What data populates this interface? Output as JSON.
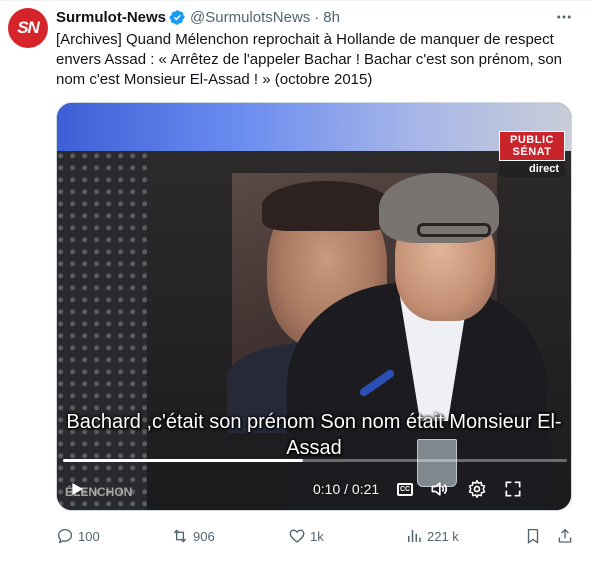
{
  "tweet": {
    "author_name": "Surmulot-News",
    "avatar_text": "SN",
    "handle": "@SurmulotsNews",
    "separator": "·",
    "time": "8h",
    "text": "[Archives] Quand Mélenchon reprochait à Hollande de manquer de respect envers Assad : « Arrêtez de l'appeler Bachar ! Bachar c'est son prénom, son nom c'est Monsieur El-Assad ! » (octobre 2015)"
  },
  "video": {
    "channel_line1": "PUBLIC",
    "channel_line2": "SÉNAT",
    "live_tag": "direct",
    "subtitle": "Bachard ,c'était son prénom Son nom était Monsieur El-Assad",
    "lower_third": "ÉLENCHON",
    "elapsed": "0:10",
    "duration": "0:21",
    "time_separator": " / ",
    "progress_fraction": 0.476,
    "cc_label": "CC"
  },
  "actions": {
    "replies": "100",
    "reposts": "906",
    "likes": "1k",
    "views": "221 k"
  },
  "colors": {
    "verified": "#1d9bf0",
    "muted_text": "#536471",
    "avatar_bg": "#d6242b",
    "channel_red": "#c9242b"
  },
  "icons": {
    "verified": "verified-badge-icon",
    "more": "more-icon",
    "play": "play-icon",
    "volume": "volume-icon",
    "settings": "gear-icon",
    "fullscreen": "fullscreen-icon",
    "reply": "reply-icon",
    "repost": "repost-icon",
    "like": "heart-icon",
    "views": "views-icon",
    "bookmark": "bookmark-icon",
    "share": "share-icon"
  }
}
